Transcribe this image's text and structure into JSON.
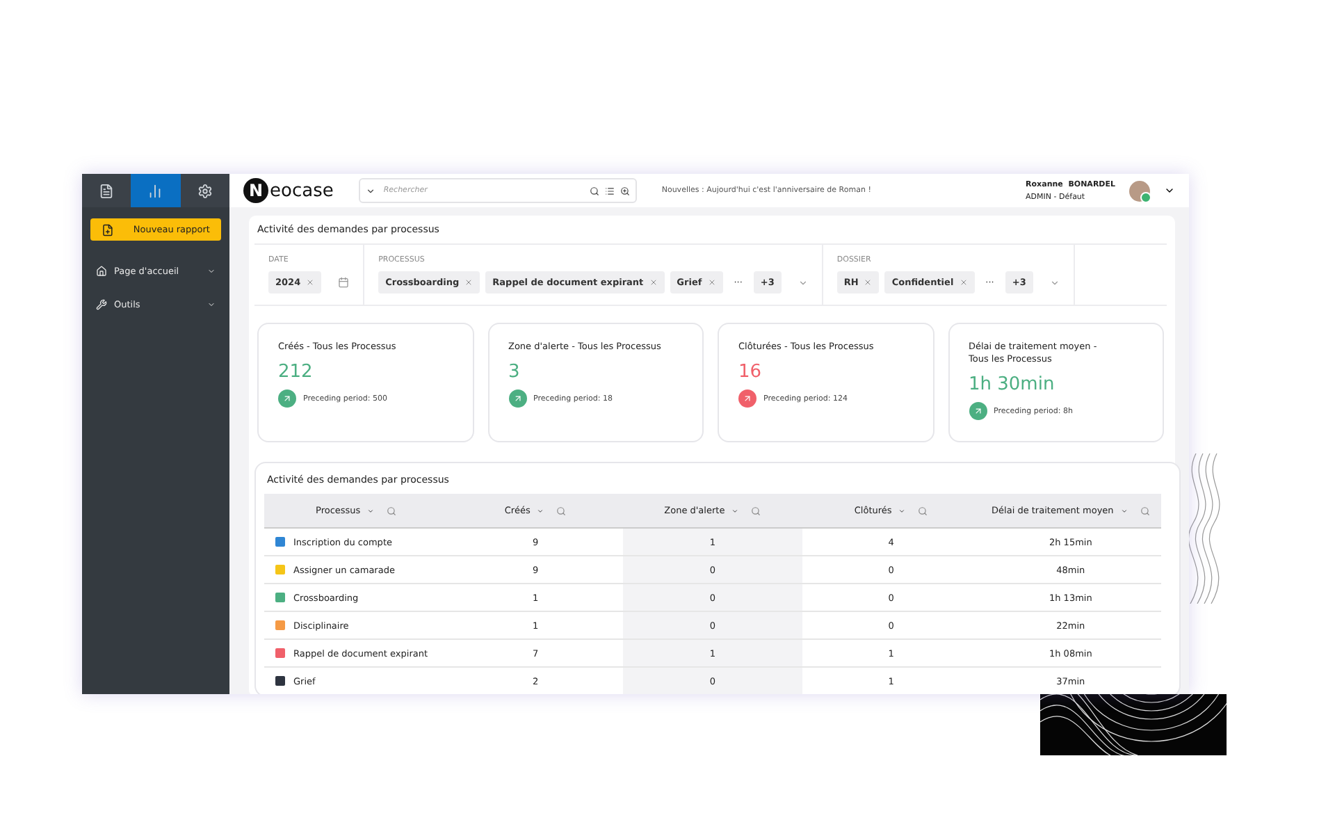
{
  "sidebar": {
    "tabs": [
      {
        "selected": false
      },
      {
        "selected": true
      },
      {
        "selected": false
      }
    ],
    "new_report": "Nouveau rapport",
    "items": [
      {
        "label": "Page d'accueil"
      },
      {
        "label": "Outils"
      }
    ]
  },
  "header": {
    "logo_letter": "N",
    "logo_rest": "eocase",
    "search": {
      "placeholder": "Rechercher"
    },
    "news": "Nouvelles : Aujourd'hui c'est l'anniversaire de Roman !",
    "user": {
      "name": "Roxanne  BONARDEL",
      "role": "ADMIN - Défaut",
      "online": true
    }
  },
  "section_title": "Activité des demandes par processus",
  "filters": [
    {
      "kind": "date",
      "label": "DATE",
      "chips": [
        "2024"
      ]
    },
    {
      "kind": "select",
      "label": "PROCESSUS",
      "chips": [
        "Crossboarding",
        "Rappel de document expirant",
        "Grief"
      ],
      "more": "···",
      "count": "+3"
    },
    {
      "kind": "select",
      "label": "DOSSIER",
      "chips": [
        "RH",
        "Confidentiel"
      ],
      "more": "···",
      "count": "+3"
    }
  ],
  "cards": [
    {
      "title": "Créés - Tous les Processus",
      "value": "212",
      "color": "#4caf82",
      "preceding": "Preceding period: 500"
    },
    {
      "title": "Zone d'alerte - Tous les Processus",
      "value": "3",
      "color": "#4caf82",
      "preceding": "Preceding period: 18"
    },
    {
      "title": "Clôturées - Tous les Processus",
      "value": "16",
      "color": "#f0606a",
      "preceding": "Preceding period: 124"
    },
    {
      "title": "Délai de traitement moyen -\nTous les Processus",
      "value": "1h 30min",
      "color": "#4caf82",
      "preceding": "Preceding period: 8h"
    }
  ],
  "table": {
    "title": "Activité des demandes par processus",
    "columns": [
      "Processus",
      "Créés",
      "Zone d'alerte",
      "Clôturés",
      "Délai de traitement moyen"
    ],
    "rows": [
      {
        "color": "#2f86d4",
        "cells": [
          "Inscription du compte",
          "9",
          "1",
          "4",
          "2h 15min"
        ]
      },
      {
        "color": "#f5c518",
        "cells": [
          "Assigner un camarade",
          "9",
          "0",
          "0",
          "48min"
        ]
      },
      {
        "color": "#4caf82",
        "cells": [
          "Crossboarding",
          "1",
          "0",
          "0",
          "1h 13min"
        ]
      },
      {
        "color": "#f59a45",
        "cells": [
          "Disciplinaire",
          "1",
          "0",
          "0",
          "22min"
        ]
      },
      {
        "color": "#f0606a",
        "cells": [
          "Rappel de document expirant",
          "7",
          "1",
          "1",
          "1h 08min"
        ]
      },
      {
        "color": "#2e3440",
        "cells": [
          "Grief",
          "2",
          "0",
          "1",
          "37min"
        ]
      }
    ]
  }
}
